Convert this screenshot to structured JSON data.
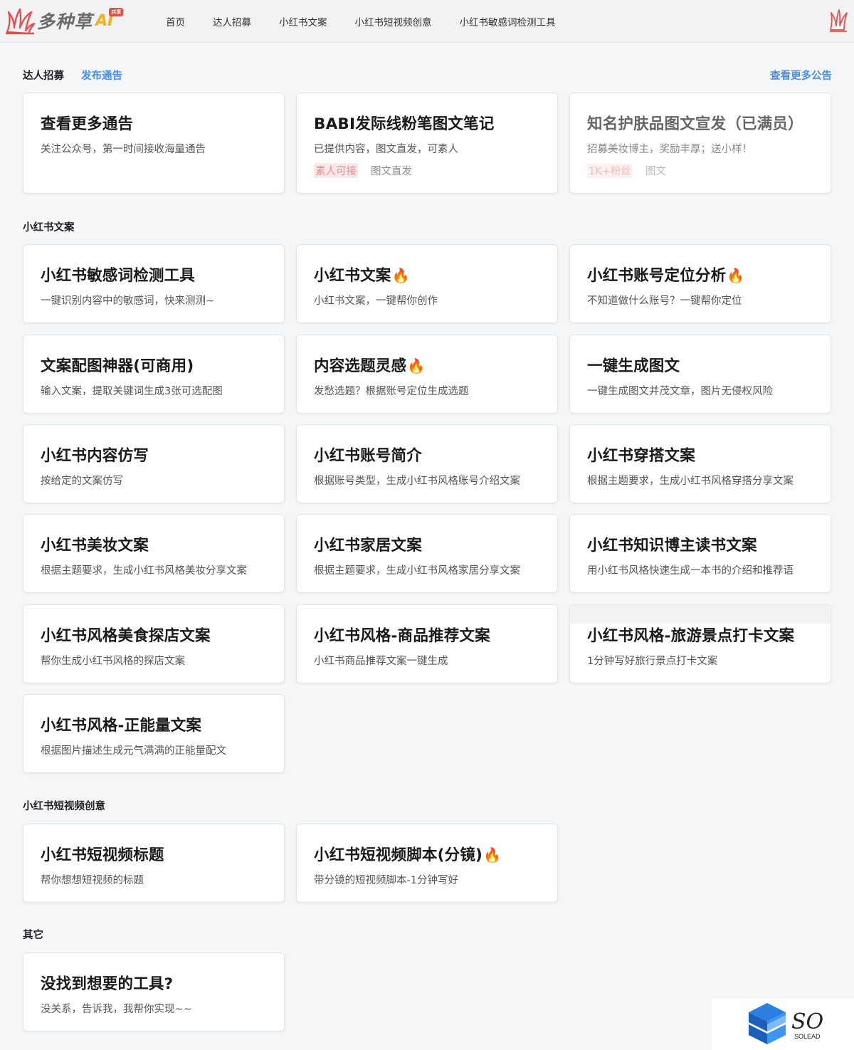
{
  "header": {
    "logo_text": "多种草",
    "logo_ai": "AI",
    "logo_badge": "共享",
    "nav": [
      "首页",
      "达人招募",
      "小红书文案",
      "小红书短视频创意",
      "小红书敏感词检测工具"
    ]
  },
  "recruit": {
    "title": "达人招募",
    "publish_link": "发布通告",
    "more_link": "查看更多公告",
    "cards": [
      {
        "title": "查看更多通告",
        "desc": "关注公众号，第一时间接收海量通告",
        "tags": []
      },
      {
        "title": "BABI发际线粉笔图文笔记",
        "desc": "已提供内容，图文直发，可素人",
        "tags": [
          "素人可接",
          "图文直发"
        ]
      },
      {
        "title": "知名护肤品图文宣发（已满员）",
        "desc": "招募美妆博主，奖励丰厚；送小样！",
        "tags": [
          "1K+粉丝",
          "图文"
        ]
      }
    ]
  },
  "copywriting": {
    "title": "小红书文案",
    "cards": [
      {
        "title": "小红书敏感词检测工具",
        "desc": "一键识别内容中的敏感词，快来测测~",
        "fire": ""
      },
      {
        "title": "小红书文案",
        "desc": "小红书文案，一键帮你创作",
        "fire": "🔥"
      },
      {
        "title": "小红书账号定位分析",
        "desc": "不知道做什么账号？一键帮你定位",
        "fire": "🔥"
      },
      {
        "title": "文案配图神器(可商用)",
        "desc": "输入文案，提取关键词生成3张可选配图",
        "fire": ""
      },
      {
        "title": "内容选题灵感",
        "desc": "发愁选题？根据账号定位生成选题",
        "fire": "🔥"
      },
      {
        "title": "一键生成图文",
        "desc": "一键生成图文并茂文章，图片无侵权风险",
        "fire": ""
      },
      {
        "title": "小红书内容仿写",
        "desc": "按给定的文案仿写",
        "fire": ""
      },
      {
        "title": "小红书账号简介",
        "desc": "根据账号类型，生成小红书风格账号介绍文案",
        "fire": ""
      },
      {
        "title": "小红书穿搭文案",
        "desc": "根据主题要求，生成小红书风格穿搭分享文案",
        "fire": ""
      },
      {
        "title": "小红书美妆文案",
        "desc": "根据主题要求，生成小红书风格美妆分享文案",
        "fire": ""
      },
      {
        "title": "小红书家居文案",
        "desc": "根据主题要求，生成小红书风格家居分享文案",
        "fire": ""
      },
      {
        "title": "小红书知识博主读书文案",
        "desc": "用小红书风格快速生成一本书的介绍和推荐语",
        "fire": ""
      },
      {
        "title": "小红书风格美食探店文案",
        "desc": "帮你生成小红书风格的探店文案",
        "fire": ""
      },
      {
        "title": "小红书风格-商品推荐文案",
        "desc": "小红书商品推荐文案一键生成",
        "fire": ""
      },
      {
        "title": "小红书风格-旅游景点打卡文案",
        "desc": "1分钟写好旅行景点打卡文案",
        "fire": ""
      },
      {
        "title": "小红书风格-正能量文案",
        "desc": "根据图片描述生成元气满满的正能量配文",
        "fire": ""
      }
    ]
  },
  "video": {
    "title": "小红书短视频创意",
    "cards": [
      {
        "title": "小红书短视频标题",
        "desc": "帮你想想短视频的标题",
        "fire": ""
      },
      {
        "title": "小红书短视频脚本(分镜)",
        "desc": "带分镜的短视频脚本-1分钟写好",
        "fire": "🔥"
      }
    ]
  },
  "other": {
    "title": "其它",
    "cards": [
      {
        "title": "没找到想要的工具?",
        "desc": "没关系，告诉我，我帮你实现~~",
        "fire": ""
      }
    ]
  },
  "watermark": {
    "text": "SO",
    "sub": "SOLEAD"
  }
}
